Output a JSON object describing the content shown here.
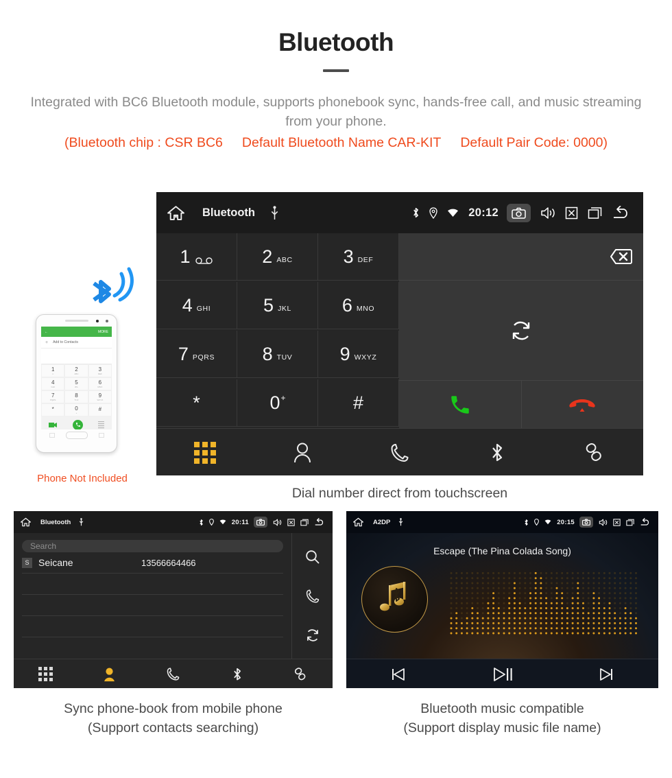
{
  "header": {
    "title": "Bluetooth",
    "intro": "Integrated with BC6 Bluetooth module, supports phonebook sync, hands-free call, and music streaming from your phone.",
    "spec_open": "(Bluetooth chip : CSR BC6",
    "spec_name": "Default Bluetooth Name CAR-KIT",
    "spec_code": "Default Pair Code: 0000)"
  },
  "phone_mock": {
    "caption": "Phone Not Included",
    "more_label": "MORE",
    "add_to_contacts": "Add to Contacts",
    "keys": [
      {
        "num": "1",
        "sub": "∞"
      },
      {
        "num": "2",
        "sub": "ABC"
      },
      {
        "num": "3",
        "sub": "DEF"
      },
      {
        "num": "4",
        "sub": "GHI"
      },
      {
        "num": "5",
        "sub": "JKL"
      },
      {
        "num": "6",
        "sub": "MNO"
      },
      {
        "num": "7",
        "sub": "PQRS"
      },
      {
        "num": "8",
        "sub": "TUV"
      },
      {
        "num": "9",
        "sub": "WXYZ"
      },
      {
        "num": "*",
        "sub": ""
      },
      {
        "num": "0",
        "sub": "+"
      },
      {
        "num": "#",
        "sub": ""
      }
    ]
  },
  "dialer": {
    "status": {
      "title": "Bluetooth",
      "time": "20:12",
      "icons": [
        "home-icon",
        "usb-icon",
        "bluetooth-icon",
        "location-icon",
        "wifi-icon",
        "camera-icon",
        "volume-icon",
        "close-box-icon",
        "recents-icon",
        "back-icon"
      ]
    },
    "keys": [
      {
        "num": "1",
        "sub": "voicemail"
      },
      {
        "num": "2",
        "sub": "ABC"
      },
      {
        "num": "3",
        "sub": "DEF"
      },
      {
        "num": "4",
        "sub": "GHI"
      },
      {
        "num": "5",
        "sub": "JKL"
      },
      {
        "num": "6",
        "sub": "MNO"
      },
      {
        "num": "7",
        "sub": "PQRS"
      },
      {
        "num": "8",
        "sub": "TUV"
      },
      {
        "num": "9",
        "sub": "WXYZ"
      },
      {
        "num": "*",
        "sub": ""
      },
      {
        "num": "0",
        "sub": "+"
      },
      {
        "num": "#",
        "sub": ""
      }
    ],
    "number_input": "",
    "tabs": [
      "keypad",
      "contacts",
      "call-log",
      "bluetooth",
      "link"
    ],
    "active_tab": "keypad",
    "caption": "Dial number direct from touchscreen",
    "accent": "#f0b429"
  },
  "contacts": {
    "status": {
      "title": "Bluetooth",
      "time": "20:11"
    },
    "search_placeholder": "Search",
    "rows": [
      {
        "badge": "S",
        "name": "Seicane",
        "number": "13566664466"
      }
    ],
    "side_icons": [
      "search-icon",
      "call-icon",
      "sync-icon"
    ],
    "tabs": [
      "keypad",
      "contacts",
      "call-log",
      "bluetooth",
      "link"
    ],
    "active_tab": "contacts",
    "caption_line1": "Sync phone-book from mobile phone",
    "caption_line2": "(Support contacts searching)"
  },
  "music": {
    "status": {
      "title": "A2DP",
      "time": "20:15"
    },
    "song_title": "Escape (The Pina Colada Song)",
    "controls": [
      "previous-icon",
      "play-pause-icon",
      "next-icon"
    ],
    "caption_line1": "Bluetooth music compatible",
    "caption_line2": "(Support display music file name)"
  },
  "colors": {
    "accent_orange": "#ef4b1e",
    "active_yellow": "#f0b429",
    "call_green": "#19c819",
    "hangup_red": "#e8341c",
    "panel_dark": "#262626"
  }
}
